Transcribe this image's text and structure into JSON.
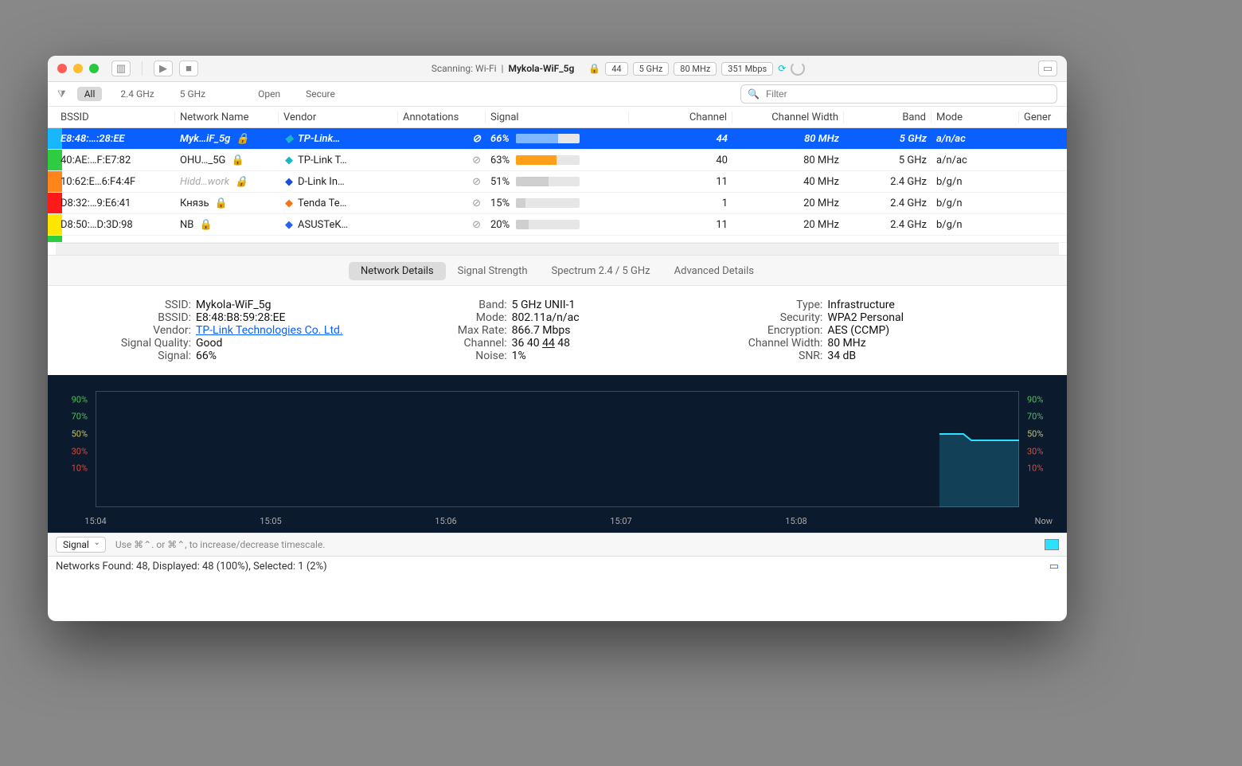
{
  "title": {
    "scanlabel": "Scanning: Wi-Fi",
    "separator": "|",
    "network": "Mykola-WiF_5g",
    "pills": [
      "44",
      "5 GHz",
      "80 MHz",
      "351 Mbps"
    ]
  },
  "filters": {
    "all": "All",
    "b24": "2.4 GHz",
    "b5": "5 GHz",
    "open": "Open",
    "secure": "Secure",
    "search_placeholder": "Filter"
  },
  "columns": [
    "BSSID",
    "Network Name",
    "Vendor",
    "Annotations",
    "Signal",
    "Channel",
    "Channel Width",
    "Band",
    "Mode",
    "Gener"
  ],
  "rows": [
    {
      "stripe": "#16b7ff",
      "bssid": "E8:48:…:28:EE",
      "name": "Myk…iF_5g",
      "locked": true,
      "vendor": "TP-Link…",
      "vcolor": "#18b8c9",
      "signal": "66%",
      "sigval": 66,
      "sigcolor": "#7fb8ff",
      "channel": "44",
      "width": "80 MHz",
      "band": "5 GHz",
      "mode": "a/n/ac",
      "selected": true
    },
    {
      "stripe": "#2ecc40",
      "bssid": "40:AE:…F:E7:82",
      "name": "OHU…_5G",
      "locked": true,
      "vendor": "TP-Link T…",
      "vcolor": "#18b8c9",
      "signal": "63%",
      "sigval": 63,
      "sigcolor": "#ff9f1a",
      "channel": "40",
      "width": "80 MHz",
      "band": "5 GHz",
      "mode": "a/n/ac"
    },
    {
      "stripe": "#ff851b",
      "bssid": "10:62:E…6:F4:4F",
      "name": "Hidd…work",
      "nfaded": true,
      "locked": true,
      "vendor": "D-Link In…",
      "vcolor": "#1d4ed8",
      "signal": "51%",
      "sigval": 51,
      "sigcolor": "#cfcfcf",
      "channel": "11",
      "width": "40 MHz",
      "band": "2.4 GHz",
      "mode": "b/g/n"
    },
    {
      "stripe": "#ff1a1a",
      "bssid": "D8:32:…9:E6:41",
      "name": "Князь",
      "locked": true,
      "vendor": "Tenda Te…",
      "vcolor": "#f97316",
      "signal": "15%",
      "sigval": 15,
      "sigcolor": "#cfcfcf",
      "channel": "1",
      "width": "20 MHz",
      "band": "2.4 GHz",
      "mode": "b/g/n"
    },
    {
      "stripe": "#ffe600",
      "bssid": "D8:50:…D:3D:98",
      "name": "NB",
      "locked": true,
      "vendor": "ASUSTeK…",
      "vcolor": "#2563eb",
      "signal": "20%",
      "sigval": 20,
      "sigcolor": "#cfcfcf",
      "channel": "11",
      "width": "20 MHz",
      "band": "2.4 GHz",
      "mode": "b/g/n"
    }
  ],
  "tabs": [
    "Network Details",
    "Signal Strength",
    "Spectrum 2.4 / 5 GHz",
    "Advanced Details"
  ],
  "tabs_active": 0,
  "details": {
    "col1": [
      {
        "label": "SSID:",
        "value": "Mykola-WiF_5g"
      },
      {
        "label": "BSSID:",
        "value": "E8:48:B8:59:28:EE"
      },
      {
        "label": "Vendor:",
        "value": "TP-Link Technologies Co. Ltd.",
        "link": true
      },
      {
        "label": "Signal Quality:",
        "value": "Good"
      },
      {
        "label": "Signal:",
        "value": "66%"
      }
    ],
    "col2": [
      {
        "label": "Band:",
        "value": "5 GHz UNII-1"
      },
      {
        "label": "Mode:",
        "value": "802.11a/n/ac"
      },
      {
        "label": "Max Rate:",
        "value": "866.7 Mbps"
      },
      {
        "label": "Channel:",
        "value": "36 40 44 48",
        "underline": "44"
      },
      {
        "label": "Noise:",
        "value": "1%"
      }
    ],
    "col3": [
      {
        "label": "Type:",
        "value": "Infrastructure"
      },
      {
        "label": "Security:",
        "value": "WPA2 Personal"
      },
      {
        "label": "Encryption:",
        "value": "AES (CCMP)"
      },
      {
        "label": "Channel Width:",
        "value": "80 MHz"
      },
      {
        "label": "SNR:",
        "value": "34 dB"
      }
    ]
  },
  "chart_data": {
    "type": "line",
    "title": "",
    "ylabel": "",
    "xlabel": "",
    "yticks": [
      10,
      30,
      50,
      70,
      90
    ],
    "ytick_colors": {
      "10": "#d84b3a",
      "30": "#d84b3a",
      "50": "#c8c25a",
      "70": "#4fbf5a",
      "90": "#4fbf5a"
    },
    "xticks": [
      "15:04",
      "15:05",
      "15:06",
      "15:07",
      "15:08",
      "Now"
    ],
    "series": [
      {
        "name": "Signal",
        "color": "#2de0ff",
        "x": [
          "15:08",
          "15:08.2",
          "Now"
        ],
        "y": [
          72,
          66,
          66
        ]
      }
    ],
    "ylim": [
      0,
      100
    ]
  },
  "bottombar": {
    "select": "Signal",
    "hint": "Use ⌘⌃. or ⌘⌃, to increase/decrease timescale."
  },
  "status": "Networks Found: 48, Displayed: 48 (100%), Selected: 1 (2%)"
}
